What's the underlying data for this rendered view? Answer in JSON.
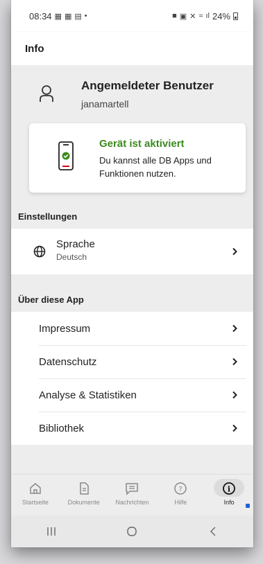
{
  "status_bar": {
    "time": "08:34",
    "left_icons": [
      "notification-icon",
      "notification-icon",
      "calendar-icon",
      "dot-icon"
    ],
    "battery": "24%"
  },
  "header": {
    "title": "Info"
  },
  "user": {
    "heading": "Angemeldeter Benutzer",
    "username": "janamartell"
  },
  "device": {
    "title": "Gerät ist aktiviert",
    "description": "Du kannst alle DB Apps und Funktionen nutzen.",
    "accent": "#3c8a1e",
    "alert_red": "#d6001c"
  },
  "settings": {
    "heading": "Einstellungen",
    "language_label": "Sprache",
    "language_value": "Deutsch"
  },
  "about": {
    "heading": "Über diese App",
    "items": [
      {
        "label": "Impressum"
      },
      {
        "label": "Datenschutz"
      },
      {
        "label": "Analyse & Statistiken"
      },
      {
        "label": "Bibliothek"
      }
    ]
  },
  "bottom_nav": {
    "items": [
      {
        "label": "Startseite",
        "icon": "home-icon"
      },
      {
        "label": "Dokumente",
        "icon": "document-icon"
      },
      {
        "label": "Nachrichten",
        "icon": "message-icon"
      },
      {
        "label": "Hilfe",
        "icon": "help-icon"
      },
      {
        "label": "Info",
        "icon": "info-icon",
        "active": true
      }
    ]
  }
}
